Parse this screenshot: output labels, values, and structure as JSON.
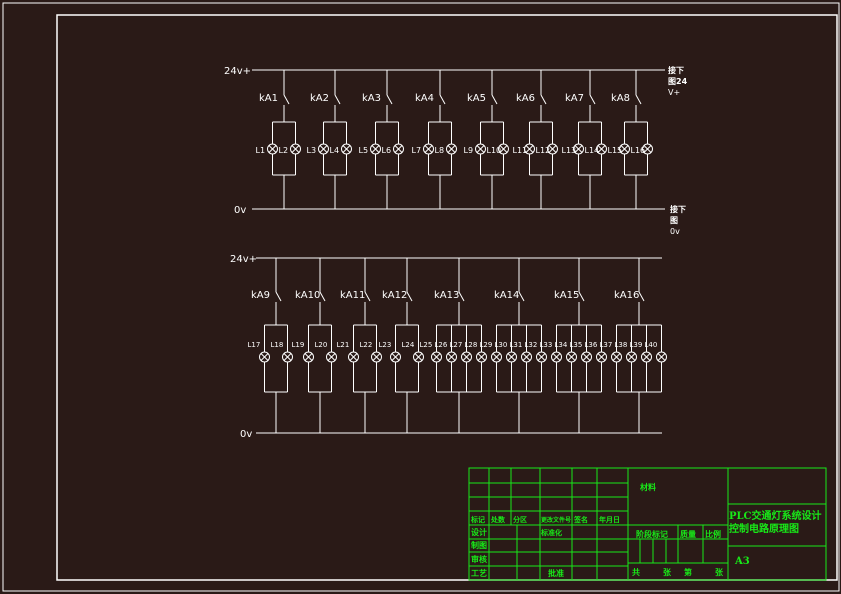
{
  "diagram": {
    "top": {
      "supply_label": "24v+",
      "ground_label": "0v",
      "note_supply": [
        "接下",
        "图24",
        "V+"
      ],
      "note_ground": [
        "接下",
        "图",
        "0v"
      ],
      "relays": [
        {
          "label": "kA1",
          "lamps": [
            "L1",
            "L2"
          ]
        },
        {
          "label": "kA2",
          "lamps": [
            "L3",
            "L4"
          ]
        },
        {
          "label": "kA3",
          "lamps": [
            "L5",
            "L6"
          ]
        },
        {
          "label": "kA4",
          "lamps": [
            "L7",
            "L8"
          ]
        },
        {
          "label": "kA5",
          "lamps": [
            "L9",
            "L10"
          ]
        },
        {
          "label": "kA6",
          "lamps": [
            "L11",
            "L12"
          ]
        },
        {
          "label": "kA7",
          "lamps": [
            "L13",
            "L14"
          ]
        },
        {
          "label": "kA8",
          "lamps": [
            "L15",
            "L16"
          ]
        }
      ]
    },
    "bottom": {
      "supply_label": "24v+",
      "ground_label": "0v",
      "relays": [
        {
          "label": "kA9",
          "lamps": [
            "L17",
            "L18"
          ]
        },
        {
          "label": "kA10",
          "lamps": [
            "L19",
            "L20"
          ]
        },
        {
          "label": "kA11",
          "lamps": [
            "L21",
            "L22"
          ]
        },
        {
          "label": "kA12",
          "lamps": [
            "L23",
            "L24"
          ]
        },
        {
          "label": "kA13",
          "lamps": [
            "L25",
            "L26",
            "L27",
            "L28"
          ]
        },
        {
          "label": "kA14",
          "lamps": [
            "L29",
            "L30",
            "L31",
            "L32"
          ]
        },
        {
          "label": "kA15",
          "lamps": [
            "L33",
            "L34",
            "L35",
            "L36"
          ]
        },
        {
          "label": "kA16",
          "lamps": [
            "L37",
            "L38",
            "L39",
            "L40"
          ]
        }
      ]
    }
  },
  "title_block": {
    "material": "材料",
    "title_line1": "PLC交通灯系统设计",
    "title_line2": "控制电路原理图",
    "scale_headers": [
      "阶段标记",
      "质量",
      "比例"
    ],
    "sheet_size": "A3",
    "revision_headers": [
      "标记",
      "处数",
      "分区",
      "更改文件号",
      "签名",
      "年月日"
    ],
    "role_labels": [
      "设计",
      "制图",
      "审核",
      "工艺"
    ],
    "std_label": "标准化",
    "approve_label": "批准",
    "sheet_labels": [
      "共",
      "张",
      "第",
      "张"
    ]
  },
  "colors": {
    "background": "#2a1a17",
    "lines": "#ffffff",
    "title_block": "#18e818"
  }
}
